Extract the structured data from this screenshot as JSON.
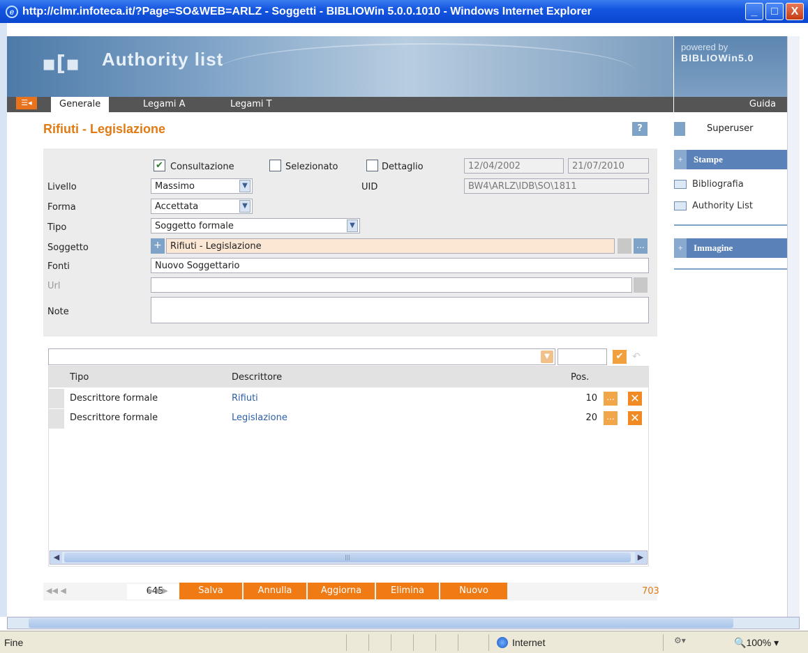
{
  "window": {
    "title": "http://clmr.infoteca.it/?Page=SO&WEB=ARLZ - Soggetti - BIBLIOWin 5.0.0.1010 - Windows Internet Explorer",
    "btn_min": "_",
    "btn_max": "□",
    "btn_close": "X"
  },
  "header": {
    "app_title": "Authority list",
    "powered_by": "powered by",
    "product": "BIBLIOWin5.0"
  },
  "tabs": {
    "generale": "Generale",
    "legami_a": "Legami A",
    "legami_t": "Legami T",
    "guida": "Guida"
  },
  "page": {
    "title": "Rifiuti - Legislazione",
    "help": "?"
  },
  "form": {
    "consultazione": "Consultazione",
    "selezionato": "Selezionato",
    "dettaglio": "Dettaglio",
    "date_created": "12/04/2002",
    "date_modified": "21/07/2010",
    "livello_label": "Livello",
    "livello_value": "Massimo",
    "uid_label": "UID",
    "uid_value": "BW4\\ARLZ\\IDB\\SO\\1811",
    "forma_label": "Forma",
    "forma_value": "Accettata",
    "tipo_label": "Tipo",
    "tipo_value": "Soggetto formale",
    "soggetto_label": "Soggetto",
    "soggetto_value": "Rifiuti - Legislazione",
    "fonti_label": "Fonti",
    "fonti_value": "Nuovo Soggettario",
    "url_label": "Url",
    "url_value": "",
    "note_label": "Note",
    "note_value": ""
  },
  "grid": {
    "col_tipo": "Tipo",
    "col_descrittore": "Descrittore",
    "col_pos": "Pos.",
    "rows": [
      {
        "tipo": "Descrittore formale",
        "descrittore": "Rifiuti",
        "pos": "10"
      },
      {
        "tipo": "Descrittore formale",
        "descrittore": "Legislazione",
        "pos": "20"
      }
    ]
  },
  "toolbar": {
    "record": "645",
    "salva": "Salva",
    "annulla": "Annulla",
    "aggiorna": "Aggiorna",
    "elimina": "Elimina",
    "nuovo": "Nuovo",
    "total": "703"
  },
  "sidebar": {
    "user": "Superuser",
    "stampe": "Stampe",
    "bibliografia": "Bibliografia",
    "authority_list": "Authority List",
    "immagine": "Immagine"
  },
  "status": {
    "left": "Fine",
    "zone": "Internet",
    "zoom": "100%"
  },
  "colors": {
    "accent": "#e07a13",
    "action_button": "#f07a14",
    "sidebar_head": "#5b82b8",
    "titlebar": "#0a46d0"
  }
}
